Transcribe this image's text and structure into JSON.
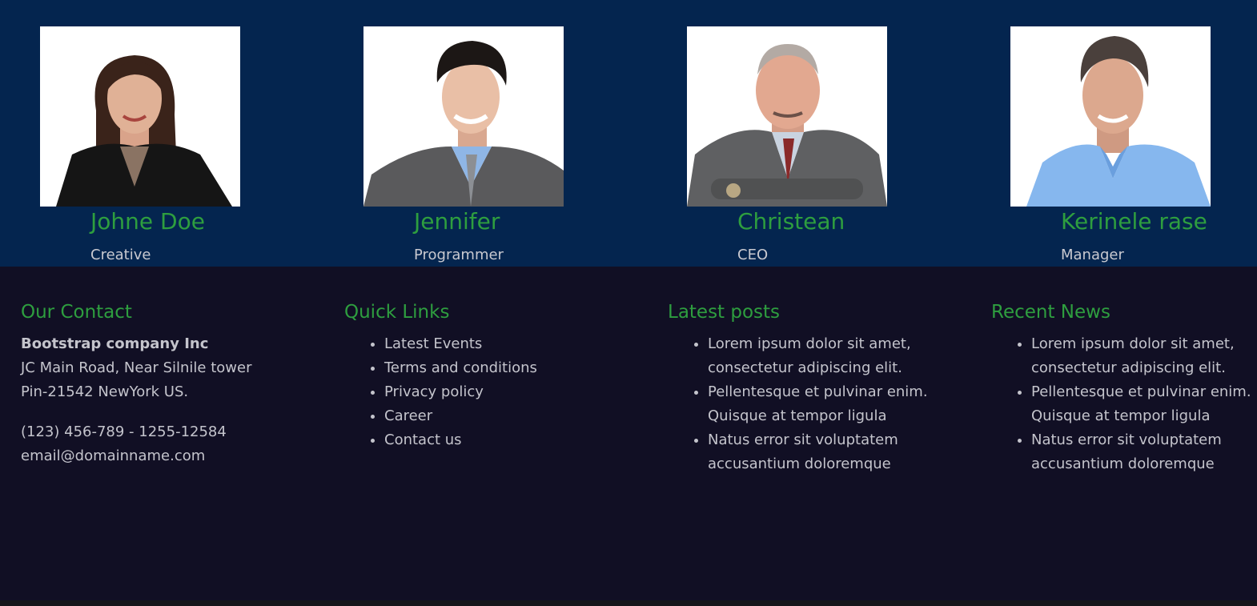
{
  "team": {
    "members": [
      {
        "name": "Johne Doe",
        "role": "Creative",
        "photo_icon": "woman-portrait-photo"
      },
      {
        "name": "Jennifer",
        "role": "Programmer",
        "photo_icon": "young-man-portrait-photo"
      },
      {
        "name": "Christean",
        "role": "CEO",
        "photo_icon": "older-man-portrait-photo"
      },
      {
        "name": "Kerinele rase",
        "role": "Manager",
        "photo_icon": "man-blue-shirt-portrait-photo"
      }
    ]
  },
  "footer": {
    "contact": {
      "heading": "Our Contact",
      "company": "Bootstrap company Inc",
      "address_line1": "JC Main Road, Near Silnile tower",
      "address_line2": "Pin-21542 NewYork US.",
      "phone": "(123) 456-789 - 1255-12584",
      "email": "email@domainname.com"
    },
    "quick_links": {
      "heading": "Quick Links",
      "items": [
        "Latest Events",
        "Terms and conditions",
        "Privacy policy",
        "Career",
        "Contact us"
      ]
    },
    "latest_posts": {
      "heading": "Latest posts",
      "items": [
        [
          "Lorem ipsum dolor sit amet,",
          "consectetur adipiscing elit."
        ],
        [
          "Pellentesque et pulvinar enim.",
          "Quisque at tempor ligula"
        ],
        [
          "Natus error sit voluptatem",
          "accusantium doloremque"
        ]
      ]
    },
    "recent_news": {
      "heading": "Recent News",
      "items": [
        [
          "Lorem ipsum dolor sit amet,",
          "consectetur adipiscing elit."
        ],
        [
          "Pellentesque et pulvinar enim.",
          "Quisque at tempor ligula"
        ],
        [
          "Natus error sit voluptatem",
          "accusantium doloremque"
        ]
      ]
    }
  },
  "colors": {
    "team_bg": "#04254f",
    "footer_bg": "#110f24",
    "accent_green": "#2e9e3f",
    "text_light": "#c4c4cc"
  }
}
